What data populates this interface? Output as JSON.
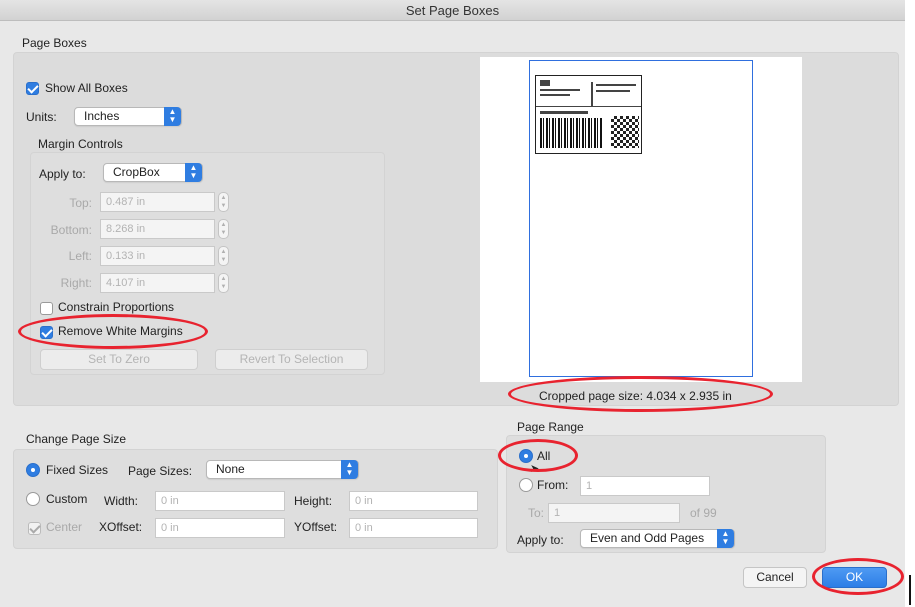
{
  "window": {
    "title": "Set Page Boxes"
  },
  "page_boxes": {
    "section_label": "Page Boxes",
    "show_all_boxes": {
      "label": "Show All Boxes",
      "checked": true
    },
    "units": {
      "label": "Units:",
      "value": "Inches"
    },
    "margin_controls": {
      "label": "Margin Controls",
      "apply_to_label": "Apply to:",
      "apply_to_value": "CropBox",
      "top": {
        "label": "Top:",
        "value": "0.487 in"
      },
      "bottom": {
        "label": "Bottom:",
        "value": "8.268 in"
      },
      "left": {
        "label": "Left:",
        "value": "0.133 in"
      },
      "right": {
        "label": "Right:",
        "value": "4.107 in"
      },
      "constrain_proportions": {
        "label": "Constrain Proportions",
        "checked": false
      },
      "remove_white_margins": {
        "label": "Remove White Margins",
        "checked": true
      },
      "set_to_zero": "Set To Zero",
      "revert_to_selection": "Revert To Selection"
    },
    "cropped_size": "Cropped page size: 4.034 x 2.935 in"
  },
  "change_page_size": {
    "section_label": "Change Page Size",
    "fixed_sizes": {
      "label": "Fixed Sizes",
      "selected": true
    },
    "page_sizes_label": "Page Sizes:",
    "page_sizes_value": "None",
    "custom": {
      "label": "Custom",
      "selected": false
    },
    "width": {
      "label": "Width:",
      "placeholder": "0 in"
    },
    "height": {
      "label": "Height:",
      "placeholder": "0 in"
    },
    "center": {
      "label": "Center",
      "checked": true
    },
    "xoffset": {
      "label": "XOffset:",
      "placeholder": "0 in"
    },
    "yoffset": {
      "label": "YOffset:",
      "placeholder": "0 in"
    }
  },
  "page_range": {
    "section_label": "Page Range",
    "all": {
      "label": "All",
      "selected": true
    },
    "from": {
      "label": "From:",
      "value": "1"
    },
    "to": {
      "label": "To:",
      "value": "1"
    },
    "of_pages": "of 99",
    "apply_to_label": "Apply to:",
    "apply_to_value": "Even and Odd Pages"
  },
  "buttons": {
    "cancel": "Cancel",
    "ok": "OK"
  },
  "colors": {
    "accent": "#2f7de1",
    "highlight": "#e8232f",
    "page_outline": "#2f6fde"
  }
}
